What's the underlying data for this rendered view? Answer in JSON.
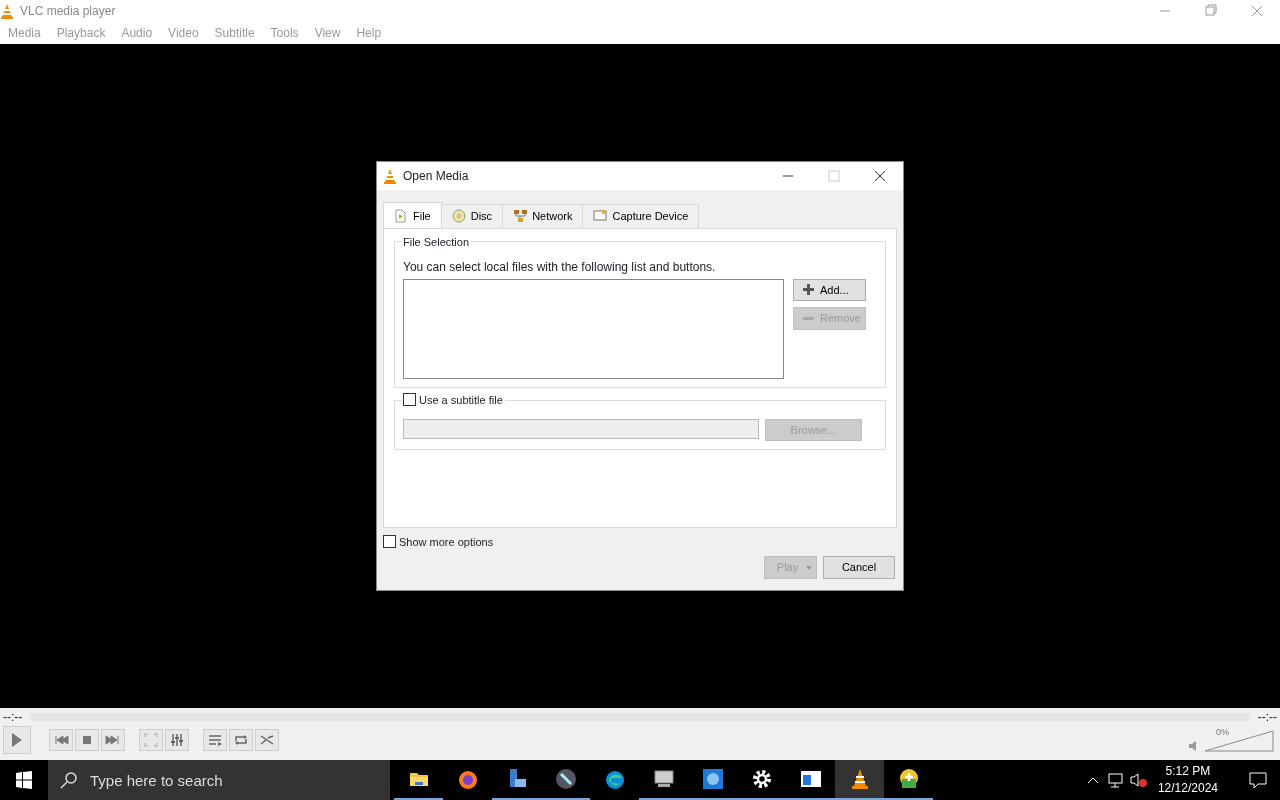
{
  "window": {
    "title": "VLC media player"
  },
  "menu": [
    "Media",
    "Playback",
    "Audio",
    "Video",
    "Subtitle",
    "Tools",
    "View",
    "Help"
  ],
  "dialog": {
    "title": "Open Media",
    "tabs": [
      {
        "label": "File",
        "kind": "file",
        "selected": true
      },
      {
        "label": "Disc",
        "kind": "disc",
        "selected": false
      },
      {
        "label": "Network",
        "kind": "network",
        "selected": false
      },
      {
        "label": "Capture Device",
        "kind": "capture",
        "selected": false
      }
    ],
    "file_selection": {
      "legend": "File Selection",
      "hint": "You can select local files with the following list and buttons.",
      "add": {
        "label": "Add...",
        "disabled": false
      },
      "remove": {
        "label": "Remove",
        "disabled": true
      }
    },
    "subtitle": {
      "label": "Use a subtitle file",
      "checked": false,
      "browse": {
        "label": "Browse...",
        "disabled": true
      }
    },
    "show_more": {
      "label": "Show more options",
      "checked": false
    },
    "play": {
      "label": "Play",
      "disabled": true
    },
    "cancel": {
      "label": "Cancel",
      "disabled": false
    }
  },
  "player": {
    "elapsed": "--:--",
    "remaining": "--:--",
    "seek": {
      "level": 0
    },
    "volume": {
      "reading": "0%",
      "level": 0
    }
  },
  "taskbar": {
    "search": {
      "placeholder": "Type here to search"
    },
    "apps": [
      {
        "kind": "folder",
        "selected": false,
        "running": true
      },
      {
        "kind": "browser",
        "selected": false,
        "running": false
      },
      {
        "kind": "server",
        "selected": false,
        "running": true
      },
      {
        "kind": "tools",
        "selected": false,
        "running": true
      },
      {
        "kind": "edge",
        "selected": false,
        "running": false
      },
      {
        "kind": "monitor",
        "selected": false,
        "running": true
      },
      {
        "kind": "globe",
        "selected": false,
        "running": true
      },
      {
        "kind": "gear",
        "selected": false,
        "running": true
      },
      {
        "kind": "window",
        "selected": false,
        "running": true
      },
      {
        "kind": "cone",
        "selected": true,
        "running": true
      },
      {
        "kind": "installer",
        "selected": false,
        "running": true
      }
    ],
    "time": "5:12 PM",
    "date": "12/12/2024"
  }
}
